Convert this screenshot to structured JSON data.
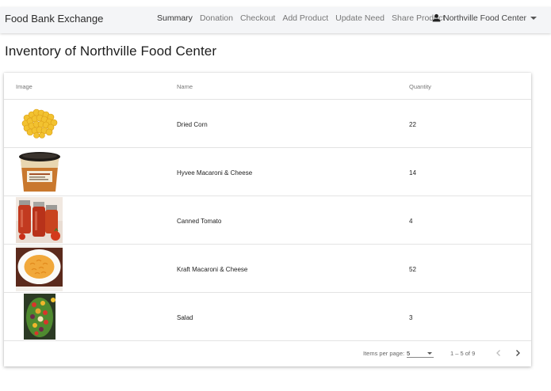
{
  "app": {
    "brand": "Food Bank Exchange"
  },
  "nav": {
    "items": [
      {
        "label": "Summary",
        "active": true
      },
      {
        "label": "Donation",
        "active": false
      },
      {
        "label": "Checkout",
        "active": false
      },
      {
        "label": "Add Product",
        "active": false
      },
      {
        "label": "Update Need",
        "active": false
      },
      {
        "label": "Share Product",
        "active": false
      }
    ],
    "user": {
      "label": "Northville Food Center",
      "icon": "person-icon"
    }
  },
  "page": {
    "title": "Inventory of Northville Food Center"
  },
  "table": {
    "columns": {
      "image": "Image",
      "name": "Name",
      "quantity": "Quantity"
    },
    "rows": [
      {
        "name": "Dried Corn",
        "quantity": "22",
        "image": "dried-corn-image"
      },
      {
        "name": "Hyvee Macaroni & Cheese",
        "quantity": "14",
        "image": "macaroni-tub-image"
      },
      {
        "name": "Canned Tomato",
        "quantity": "4",
        "image": "canned-tomato-image"
      },
      {
        "name": "Kraft Macaroni & Cheese",
        "quantity": "52",
        "image": "macaroni-bowl-image"
      },
      {
        "name": "Salad",
        "quantity": "3",
        "image": "salad-image"
      }
    ]
  },
  "paginator": {
    "items_per_page_label": "Items per page:",
    "items_per_page_value": "5",
    "range_label": "1 – 5 of 9"
  },
  "colors": {
    "navbar_bg": "#f4f5f7",
    "text_primary": "#212121",
    "text_muted": "#777777",
    "divider": "#e3e3e3"
  }
}
